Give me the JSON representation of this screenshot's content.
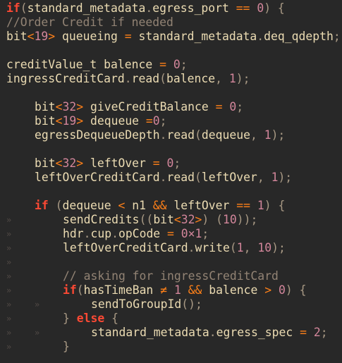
{
  "editor": {
    "theme_colors": {
      "background": "#282828",
      "text": "#ebdbb2",
      "keyword": "#fb4934",
      "comment": "#928374",
      "number": "#d3869b",
      "operator": "#fe8019",
      "punctuation": "#a89984",
      "indent_guide": "#504945"
    },
    "lines": [
      {
        "indent": 0,
        "guides": [],
        "tokens": [
          {
            "t": "if",
            "c": "kw"
          },
          {
            "t": "(",
            "c": "pn"
          },
          {
            "t": "standard_metadata",
            "c": "tx"
          },
          {
            "t": ".",
            "c": "pn"
          },
          {
            "t": "egress_port ",
            "c": "tx"
          },
          {
            "t": "==",
            "c": "op"
          },
          {
            "t": " ",
            "c": "tx"
          },
          {
            "t": "0",
            "c": "num"
          },
          {
            "t": ") {",
            "c": "pn"
          }
        ]
      },
      {
        "indent": 0,
        "guides": [],
        "tokens": [
          {
            "t": "//Order Credit if needed",
            "c": "cm"
          }
        ]
      },
      {
        "indent": 0,
        "guides": [],
        "tokens": [
          {
            "t": "bit",
            "c": "tx"
          },
          {
            "t": "<",
            "c": "op"
          },
          {
            "t": "19",
            "c": "num"
          },
          {
            "t": ">",
            "c": "op"
          },
          {
            "t": " queueing ",
            "c": "tx"
          },
          {
            "t": "=",
            "c": "op"
          },
          {
            "t": " standard_metadata",
            "c": "tx"
          },
          {
            "t": ".",
            "c": "pn"
          },
          {
            "t": "deq_qdepth",
            "c": "tx"
          },
          {
            "t": ";",
            "c": "pn"
          }
        ]
      },
      {
        "indent": 0,
        "guides": [],
        "tokens": []
      },
      {
        "indent": 0,
        "guides": [],
        "tokens": [
          {
            "t": "creditValue_t balence ",
            "c": "tx"
          },
          {
            "t": "=",
            "c": "op"
          },
          {
            "t": " ",
            "c": "tx"
          },
          {
            "t": "0",
            "c": "num"
          },
          {
            "t": ";",
            "c": "pn"
          }
        ]
      },
      {
        "indent": 0,
        "guides": [],
        "tokens": [
          {
            "t": "ingressCreditCard",
            "c": "tx"
          },
          {
            "t": ".",
            "c": "pn"
          },
          {
            "t": "read",
            "c": "tx"
          },
          {
            "t": "(",
            "c": "pn"
          },
          {
            "t": "balence",
            "c": "tx"
          },
          {
            "t": ", ",
            "c": "pn"
          },
          {
            "t": "1",
            "c": "num"
          },
          {
            "t": ");",
            "c": "pn"
          }
        ]
      },
      {
        "indent": 0,
        "guides": [],
        "tokens": []
      },
      {
        "indent": 4,
        "guides": [],
        "tokens": [
          {
            "t": "bit",
            "c": "tx"
          },
          {
            "t": "<",
            "c": "op"
          },
          {
            "t": "32",
            "c": "num"
          },
          {
            "t": ">",
            "c": "op"
          },
          {
            "t": " giveCreditBalance ",
            "c": "tx"
          },
          {
            "t": "=",
            "c": "op"
          },
          {
            "t": " ",
            "c": "tx"
          },
          {
            "t": "0",
            "c": "num"
          },
          {
            "t": ";",
            "c": "pn"
          }
        ]
      },
      {
        "indent": 4,
        "guides": [],
        "tokens": [
          {
            "t": "bit",
            "c": "tx"
          },
          {
            "t": "<",
            "c": "op"
          },
          {
            "t": "19",
            "c": "num"
          },
          {
            "t": ">",
            "c": "op"
          },
          {
            "t": " dequeue ",
            "c": "tx"
          },
          {
            "t": "=",
            "c": "op"
          },
          {
            "t": "0",
            "c": "num"
          },
          {
            "t": ";",
            "c": "pn"
          }
        ]
      },
      {
        "indent": 4,
        "guides": [],
        "tokens": [
          {
            "t": "egressDequeueDepth",
            "c": "tx"
          },
          {
            "t": ".",
            "c": "pn"
          },
          {
            "t": "read",
            "c": "tx"
          },
          {
            "t": "(",
            "c": "pn"
          },
          {
            "t": "dequeue",
            "c": "tx"
          },
          {
            "t": ", ",
            "c": "pn"
          },
          {
            "t": "1",
            "c": "num"
          },
          {
            "t": ");",
            "c": "pn"
          }
        ]
      },
      {
        "indent": 0,
        "guides": [],
        "tokens": []
      },
      {
        "indent": 4,
        "guides": [],
        "tokens": [
          {
            "t": "bit",
            "c": "tx"
          },
          {
            "t": "<",
            "c": "op"
          },
          {
            "t": "32",
            "c": "num"
          },
          {
            "t": ">",
            "c": "op"
          },
          {
            "t": " leftOver ",
            "c": "tx"
          },
          {
            "t": "=",
            "c": "op"
          },
          {
            "t": " ",
            "c": "tx"
          },
          {
            "t": "0",
            "c": "num"
          },
          {
            "t": ";",
            "c": "pn"
          }
        ]
      },
      {
        "indent": 4,
        "guides": [],
        "tokens": [
          {
            "t": "leftOverCreditCard",
            "c": "tx"
          },
          {
            "t": ".",
            "c": "pn"
          },
          {
            "t": "read",
            "c": "tx"
          },
          {
            "t": "(",
            "c": "pn"
          },
          {
            "t": "leftOver",
            "c": "tx"
          },
          {
            "t": ", ",
            "c": "pn"
          },
          {
            "t": "1",
            "c": "num"
          },
          {
            "t": ");",
            "c": "pn"
          }
        ]
      },
      {
        "indent": 0,
        "guides": [],
        "tokens": []
      },
      {
        "indent": 4,
        "guides": [],
        "tokens": [
          {
            "t": "if",
            "c": "kw"
          },
          {
            "t": " (",
            "c": "pn"
          },
          {
            "t": "dequeue ",
            "c": "tx"
          },
          {
            "t": "<",
            "c": "op"
          },
          {
            "t": " n1 ",
            "c": "tx"
          },
          {
            "t": "&&",
            "c": "op"
          },
          {
            "t": " leftOver ",
            "c": "tx"
          },
          {
            "t": "==",
            "c": "op"
          },
          {
            "t": " ",
            "c": "tx"
          },
          {
            "t": "1",
            "c": "num"
          },
          {
            "t": ") {",
            "c": "pn"
          }
        ]
      },
      {
        "indent": 8,
        "guides": [
          "»"
        ],
        "tokens": [
          {
            "t": "sendCredits",
            "c": "tx"
          },
          {
            "t": "((",
            "c": "pn"
          },
          {
            "t": "bit",
            "c": "tx"
          },
          {
            "t": "<",
            "c": "op"
          },
          {
            "t": "32",
            "c": "num"
          },
          {
            "t": ">",
            "c": "op"
          },
          {
            "t": ") (",
            "c": "pn"
          },
          {
            "t": "10",
            "c": "num"
          },
          {
            "t": "));",
            "c": "pn"
          }
        ]
      },
      {
        "indent": 8,
        "guides": [
          "»"
        ],
        "tokens": [
          {
            "t": "hdr",
            "c": "tx"
          },
          {
            "t": ".",
            "c": "pn"
          },
          {
            "t": "cup",
            "c": "tx"
          },
          {
            "t": ".",
            "c": "pn"
          },
          {
            "t": "opCode ",
            "c": "tx"
          },
          {
            "t": "=",
            "c": "op"
          },
          {
            "t": " ",
            "c": "tx"
          },
          {
            "t": "0×1",
            "c": "num"
          },
          {
            "t": ";",
            "c": "pn"
          }
        ]
      },
      {
        "indent": 8,
        "guides": [
          "»"
        ],
        "tokens": [
          {
            "t": "leftOverCreditCard",
            "c": "tx"
          },
          {
            "t": ".",
            "c": "pn"
          },
          {
            "t": "write",
            "c": "tx"
          },
          {
            "t": "(",
            "c": "pn"
          },
          {
            "t": "1",
            "c": "num"
          },
          {
            "t": ", ",
            "c": "pn"
          },
          {
            "t": "10",
            "c": "num"
          },
          {
            "t": ");",
            "c": "pn"
          }
        ]
      },
      {
        "indent": 0,
        "guides": [
          "»"
        ],
        "tokens": []
      },
      {
        "indent": 8,
        "guides": [
          "»"
        ],
        "tokens": [
          {
            "t": "// asking for ingressCreditCard",
            "c": "cm"
          }
        ]
      },
      {
        "indent": 8,
        "guides": [
          "»"
        ],
        "tokens": [
          {
            "t": "if",
            "c": "kw"
          },
          {
            "t": "(",
            "c": "pn"
          },
          {
            "t": "hasTimeBan ",
            "c": "tx"
          },
          {
            "t": "≠",
            "c": "op"
          },
          {
            "t": " ",
            "c": "tx"
          },
          {
            "t": "1",
            "c": "num"
          },
          {
            "t": " ",
            "c": "tx"
          },
          {
            "t": "&&",
            "c": "op"
          },
          {
            "t": " balence ",
            "c": "tx"
          },
          {
            "t": ">",
            "c": "op"
          },
          {
            "t": " ",
            "c": "tx"
          },
          {
            "t": "0",
            "c": "num"
          },
          {
            "t": ") {",
            "c": "pn"
          }
        ]
      },
      {
        "indent": 12,
        "guides": [
          "»",
          "»"
        ],
        "tokens": [
          {
            "t": "sendToGroupId",
            "c": "tx"
          },
          {
            "t": "();",
            "c": "pn"
          }
        ]
      },
      {
        "indent": 8,
        "guides": [
          "»"
        ],
        "tokens": [
          {
            "t": "} ",
            "c": "pn"
          },
          {
            "t": "else",
            "c": "kw"
          },
          {
            "t": " {",
            "c": "pn"
          }
        ]
      },
      {
        "indent": 12,
        "guides": [
          "»",
          "»"
        ],
        "tokens": [
          {
            "t": "standard_metadata",
            "c": "tx"
          },
          {
            "t": ".",
            "c": "pn"
          },
          {
            "t": "egress_spec ",
            "c": "tx"
          },
          {
            "t": "=",
            "c": "op"
          },
          {
            "t": " ",
            "c": "tx"
          },
          {
            "t": "2",
            "c": "num"
          },
          {
            "t": ";",
            "c": "pn"
          }
        ]
      },
      {
        "indent": 8,
        "guides": [
          "»"
        ],
        "tokens": [
          {
            "t": "}",
            "c": "pn"
          }
        ]
      }
    ]
  }
}
